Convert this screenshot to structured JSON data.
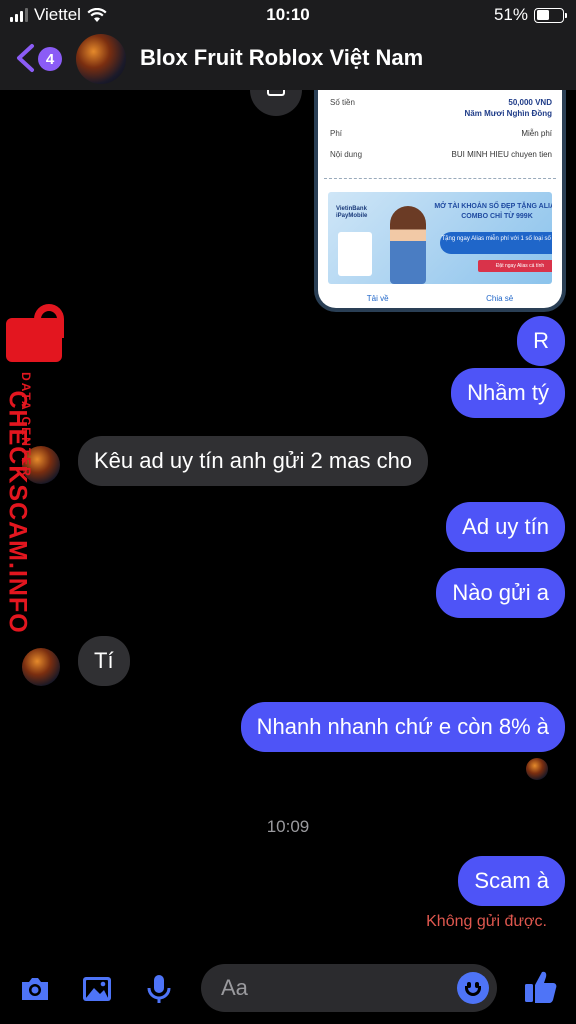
{
  "status_bar": {
    "carrier": "Viettel",
    "time": "10:10",
    "battery": "51%",
    "battery_level": 0.51
  },
  "header": {
    "unread_count": "4",
    "title": "Blox Fruit Roblox Việt Nam",
    "back_icon": "chevron-left-icon"
  },
  "receipt": {
    "rows": [
      {
        "label": "Số tiền",
        "value": "50,000 VND"
      },
      {
        "label": "",
        "value": "Năm Mươi Nghìn Đồng"
      },
      {
        "label": "Phí",
        "value": "Miễn phí"
      },
      {
        "label": "Nội dung",
        "value": "BUI MINH HIEU chuyen tien"
      }
    ],
    "promo_brand": "VietinBank iPayMobile",
    "promo_headline": "MỞ TÀI KHOẢN SỐ ĐẸP TẶNG ALIAS COMBO CHỈ TỪ 999K",
    "promo_pill": "Tặng ngay Alias miễn phí với 1 số loại số đẹp",
    "promo_cta": "Đặt ngay Alias cá tính",
    "actions": {
      "download": "Tải về",
      "share": "Chia sẻ"
    }
  },
  "messages": [
    {
      "text": "R",
      "direction": "out"
    },
    {
      "text": "Nhầm tý",
      "direction": "out"
    },
    {
      "text": "Kêu ad uy tín anh gửi 2 mas cho",
      "direction": "in"
    },
    {
      "text": "Ad uy tín",
      "direction": "out"
    },
    {
      "text": "Nào gửi a",
      "direction": "out"
    },
    {
      "text": "Tí",
      "direction": "in"
    },
    {
      "text": "Nhanh nhanh chứ e còn 8% à",
      "direction": "out"
    },
    {
      "text": "Scam à",
      "direction": "out"
    }
  ],
  "timestamp": "10:09",
  "failed_note": "Không gửi được.",
  "watermark": {
    "small": "DATA CENTER",
    "big": "CHECKSCAM.INFO"
  },
  "composer": {
    "placeholder": "Aa"
  },
  "colors": {
    "outgoing": "#4e54f7",
    "incoming": "#303033",
    "accent": "#8b5cf6",
    "error": "#e0584f",
    "watermark": "#e3161f"
  }
}
